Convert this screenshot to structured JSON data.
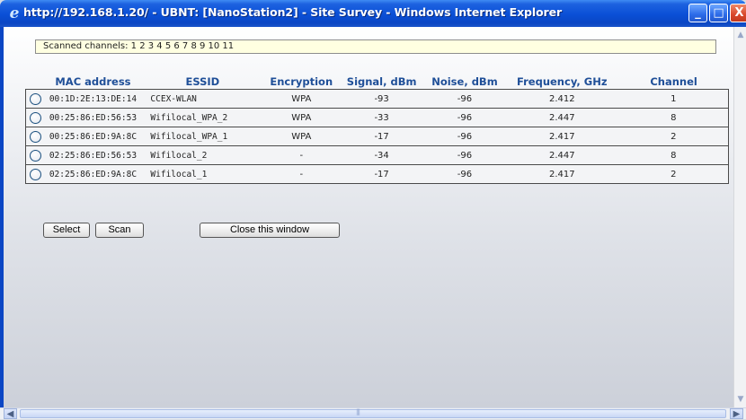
{
  "window": {
    "title": "http://192.168.1.20/ - UBNT: [NanoStation2] - Site Survey - Windows Internet Explorer",
    "minimize_glyph": "_",
    "maximize_glyph": "□",
    "close_glyph": "X"
  },
  "channels": {
    "label": "Scanned channels: 1 2 3 4 5 6 7 8 9 10 11"
  },
  "table": {
    "headers": [
      "MAC address",
      "ESSID",
      "Encryption",
      "Signal, dBm",
      "Noise, dBm",
      "Frequency, GHz",
      "Channel"
    ],
    "rows": [
      {
        "mac": "00:1D:2E:13:DE:14",
        "essid": "CCEX-WLAN",
        "encryption": "WPA",
        "signal": "-93",
        "noise": "-96",
        "frequency": "2.412",
        "channel": "1"
      },
      {
        "mac": "00:25:86:ED:56:53",
        "essid": "Wifilocal_WPA_2",
        "encryption": "WPA",
        "signal": "-33",
        "noise": "-96",
        "frequency": "2.447",
        "channel": "8"
      },
      {
        "mac": "00:25:86:ED:9A:8C",
        "essid": "Wifilocal_WPA_1",
        "encryption": "WPA",
        "signal": "-17",
        "noise": "-96",
        "frequency": "2.417",
        "channel": "2"
      },
      {
        "mac": "02:25:86:ED:56:53",
        "essid": "Wifilocal_2",
        "encryption": "-",
        "signal": "-34",
        "noise": "-96",
        "frequency": "2.447",
        "channel": "8"
      },
      {
        "mac": "02:25:86:ED:9A:8C",
        "essid": "Wifilocal_1",
        "encryption": "-",
        "signal": "-17",
        "noise": "-96",
        "frequency": "2.417",
        "channel": "2"
      }
    ]
  },
  "buttons": {
    "select": "Select",
    "scan": "Scan",
    "close": "Close this window"
  },
  "colors": {
    "header_text": "#1f4f98",
    "titlebar": "#0b46c4",
    "channels_bg": "#ffffe1"
  },
  "icons": {
    "app": "internet-explorer-icon"
  }
}
